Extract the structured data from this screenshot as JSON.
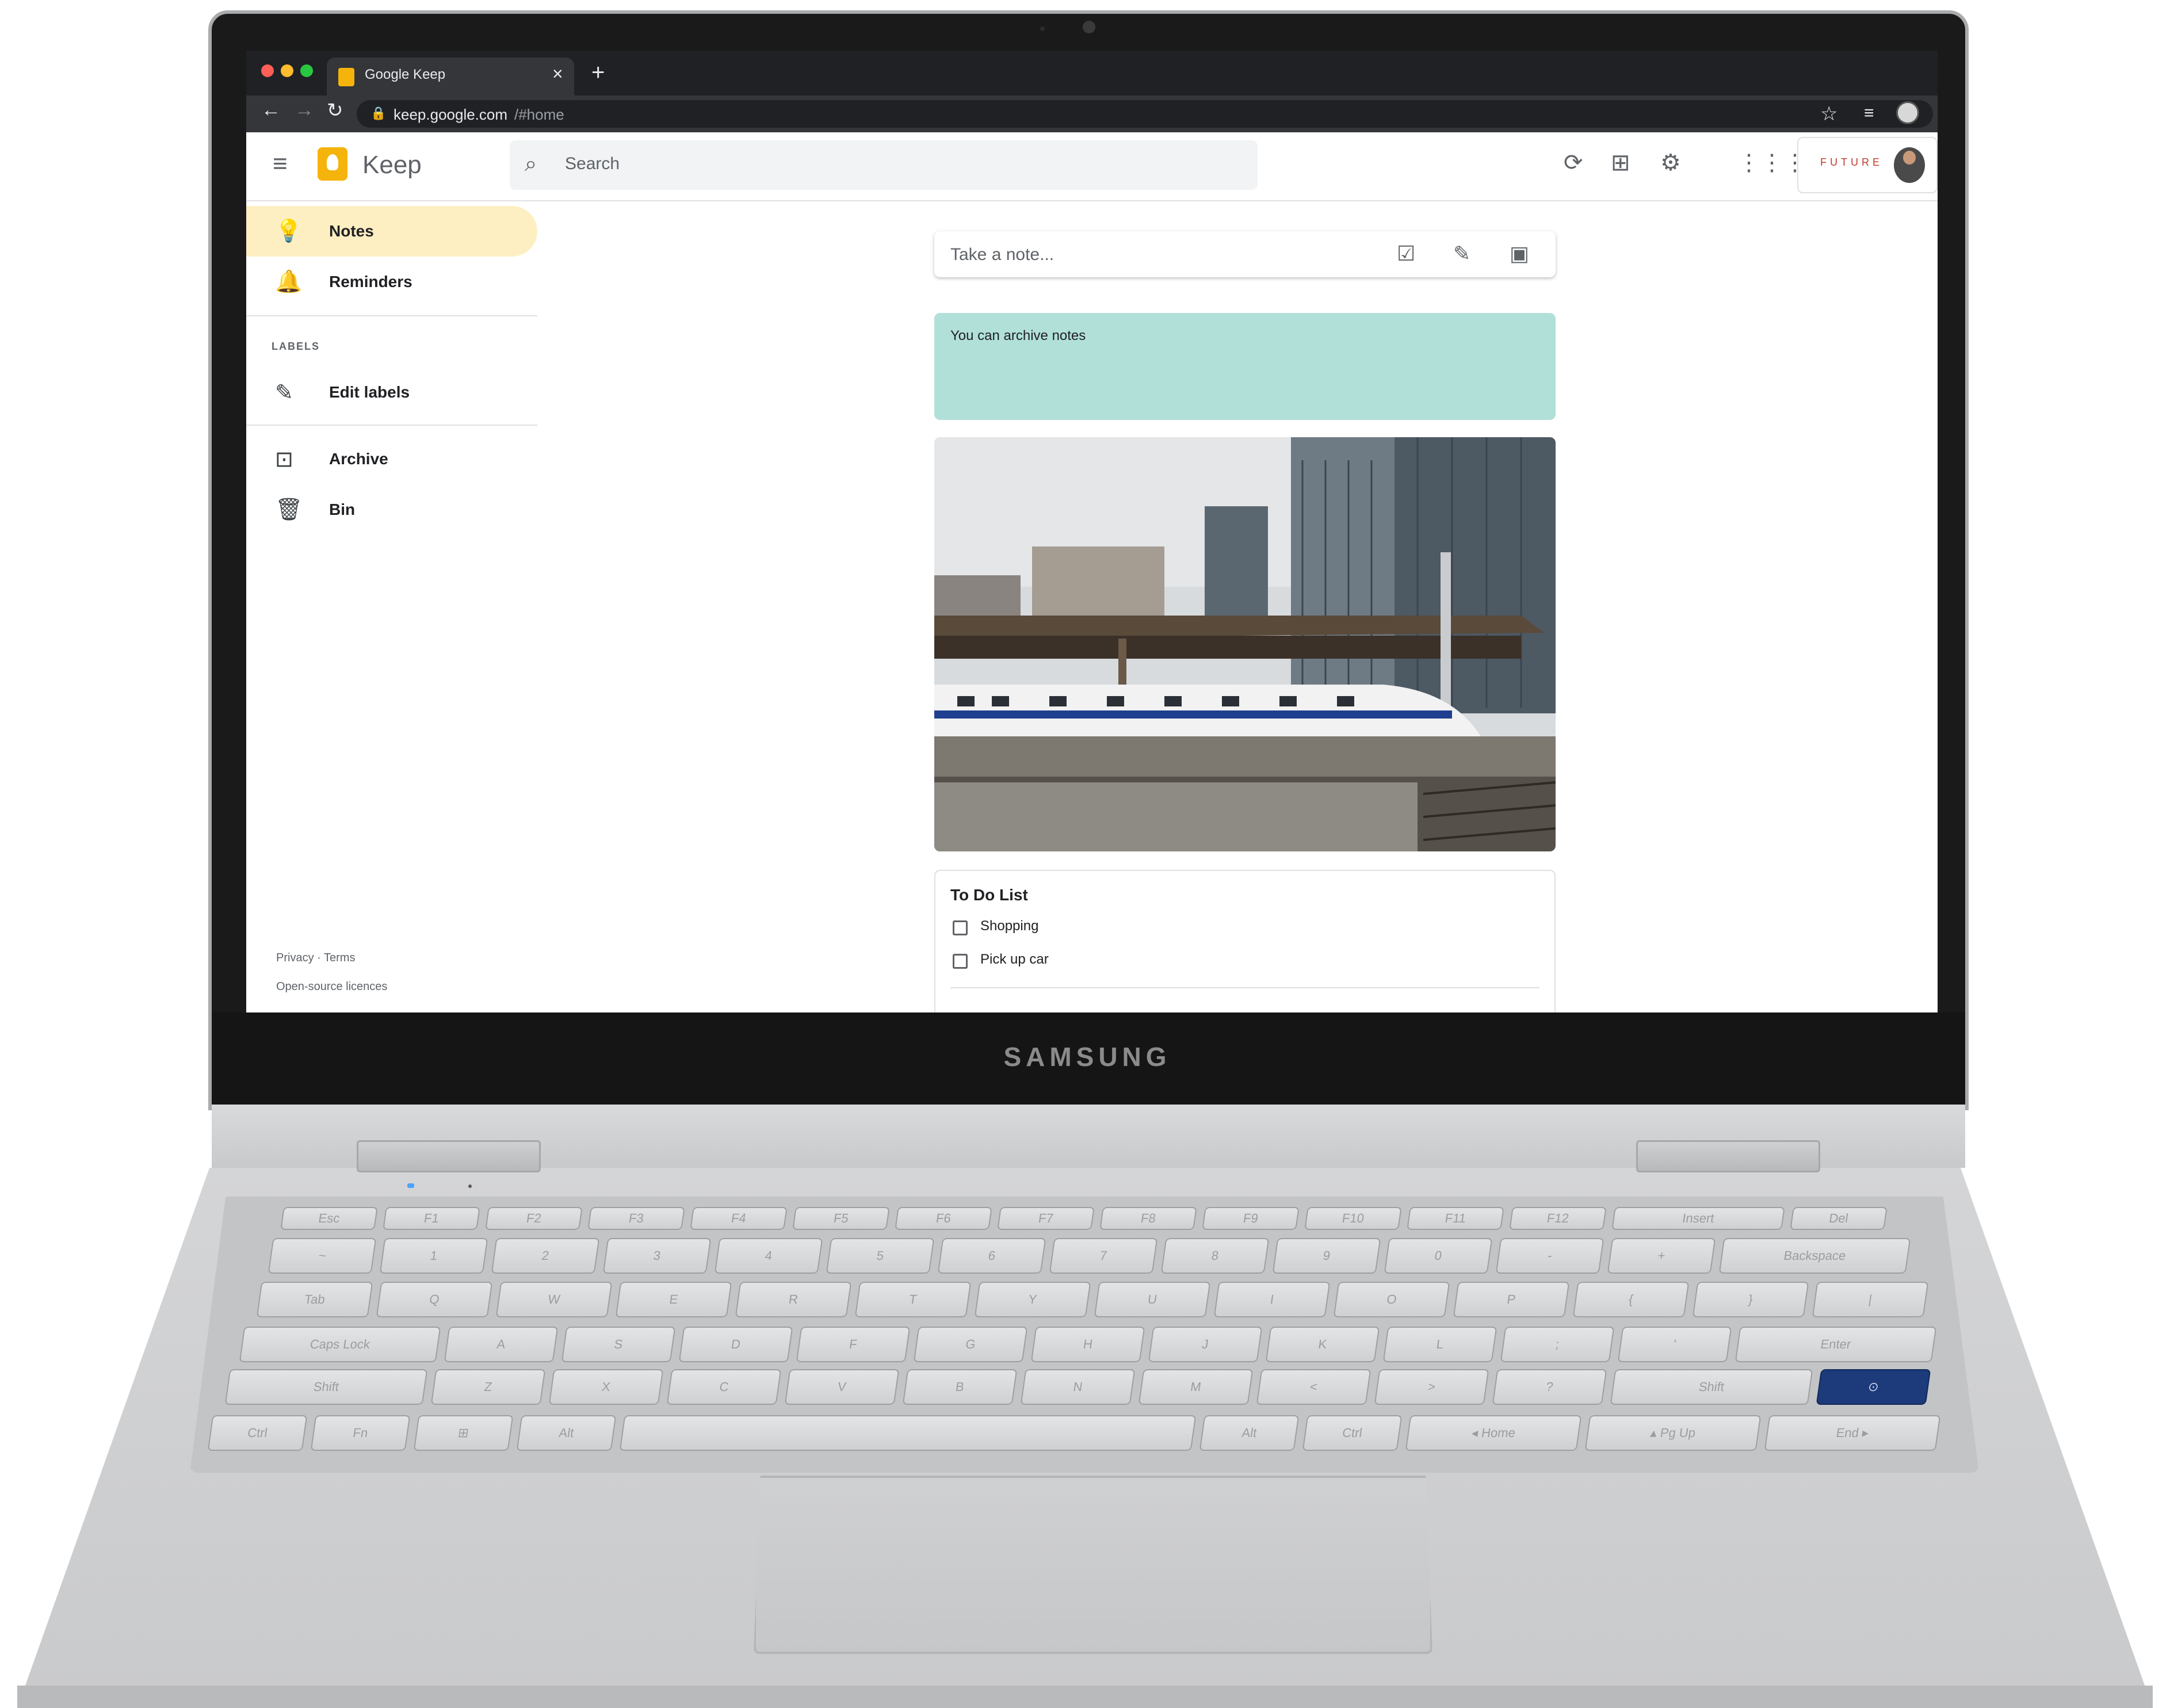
{
  "laptop": {
    "brand": "SAMSUNG"
  },
  "browser": {
    "tab_title": "Google Keep",
    "tab_close": "×",
    "new_tab": "+",
    "url_host": "keep.google.com",
    "url_path": "/#home",
    "back": "←",
    "forward": "→",
    "reload": "↻",
    "lock": "🔒",
    "star": "☆",
    "reading_list": "≡"
  },
  "keep": {
    "app_title": "Keep",
    "search_placeholder": "Search",
    "header_icons": [
      "refresh-icon",
      "grid-view-icon",
      "settings-icon",
      "apps-icon"
    ],
    "account_brand": "FUTURE"
  },
  "sidebar": {
    "items": [
      {
        "label": "Notes",
        "icon": "lightbulb-icon",
        "active": true
      },
      {
        "label": "Reminders",
        "icon": "bell-icon"
      },
      {
        "label": "Edit labels",
        "icon": "pencil-icon"
      },
      {
        "label": "Archive",
        "icon": "archive-icon"
      },
      {
        "label": "Bin",
        "icon": "trash-icon"
      }
    ],
    "labels_heading": "LABELS",
    "footer_privacy": "Privacy",
    "footer_sep": "·",
    "footer_terms": "Terms",
    "footer_licences": "Open-source licences"
  },
  "main": {
    "take_note_placeholder": "Take a note...",
    "notes": [
      {
        "type": "text",
        "text": "You can archive notes",
        "color": "#b1e0d9"
      },
      {
        "type": "image",
        "alt": "photo-train-station"
      },
      {
        "type": "checklist",
        "title": "To Do List",
        "items": [
          "Shopping",
          "Pick up car"
        ]
      }
    ]
  },
  "keyboard": {
    "rows": [
      [
        "Esc",
        "F1",
        "F2",
        "F3",
        "F4",
        "F5",
        "F6",
        "F7",
        "F8",
        "F9",
        "F10",
        "F11",
        "F12",
        "Insert",
        "Del"
      ],
      [
        "~",
        "1",
        "2",
        "3",
        "4",
        "5",
        "6",
        "7",
        "8",
        "9",
        "0",
        "-",
        "+",
        "Backspace"
      ],
      [
        "Tab",
        "Q",
        "W",
        "E",
        "R",
        "T",
        "Y",
        "U",
        "I",
        "O",
        "P",
        "{",
        "}",
        "|"
      ],
      [
        "Caps Lock",
        "A",
        "S",
        "D",
        "F",
        "G",
        "H",
        "J",
        "K",
        "L",
        ";",
        "'",
        "Enter"
      ],
      [
        "Shift",
        "Z",
        "X",
        "C",
        "V",
        "B",
        "N",
        "M",
        "<",
        ">",
        "?",
        "Shift",
        "⊙"
      ],
      [
        "Ctrl",
        "Fn",
        "⊞",
        "Alt",
        "",
        "Alt",
        "Ctrl",
        "◂ Home",
        "▴ Pg Up",
        "End ▸"
      ]
    ]
  }
}
